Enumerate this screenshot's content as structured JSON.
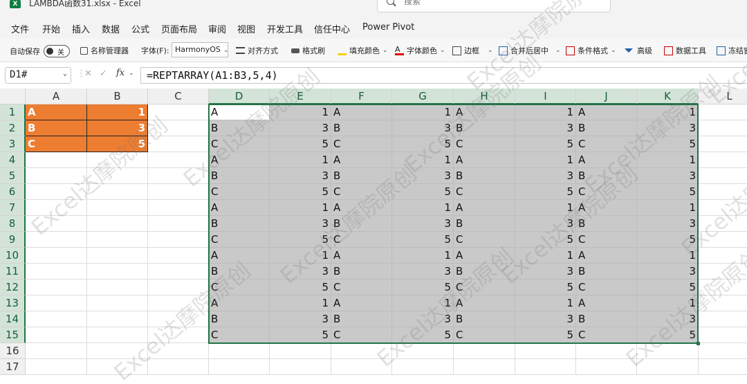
{
  "window": {
    "title": "LAMBDA函数31.xlsx  -  Excel",
    "app_icon": "X",
    "search_placeholder": "搜索"
  },
  "menu": [
    "文件",
    "开始",
    "插入",
    "数据",
    "公式",
    "页面布局",
    "审阅",
    "视图",
    "开发工具",
    "信任中心",
    "Power Pivot"
  ],
  "ribbon": {
    "autosave_label": "自动保存",
    "autosave_state": "关",
    "name_manager": "名称管理器",
    "font_label": "字体(F):",
    "font_value": "HarmonyOS",
    "align": "对齐方式",
    "format_painter": "格式刷",
    "fill_color": "填充颜色",
    "font_color": "字体颜色",
    "border": "边框",
    "merge_center": "合并后居中",
    "conditional_format": "条件格式",
    "advanced": "高级",
    "data_tools": "数据工具",
    "freeze": "冻结窗"
  },
  "formula_bar": {
    "name_box": "D1#",
    "fx": "fx",
    "cancel": "✕",
    "enter": "✓",
    "formula": "=REPTARRAY(A1:B3,5,4)"
  },
  "columns": [
    "A",
    "B",
    "C",
    "D",
    "E",
    "F",
    "G",
    "H",
    "I",
    "J",
    "K",
    "L"
  ],
  "rows": [
    "1",
    "2",
    "3",
    "4",
    "5",
    "6",
    "7",
    "8",
    "9",
    "10",
    "11",
    "12",
    "13",
    "14",
    "15",
    "16",
    "17"
  ],
  "source": [
    [
      "A",
      "1"
    ],
    [
      "B",
      "3"
    ],
    [
      "C",
      "5"
    ]
  ],
  "spill": [
    [
      "A",
      "1",
      "A",
      "1",
      "A",
      "1",
      "A",
      "1"
    ],
    [
      "B",
      "3",
      "B",
      "3",
      "B",
      "3",
      "B",
      "3"
    ],
    [
      "C",
      "5",
      "C",
      "5",
      "C",
      "5",
      "C",
      "5"
    ],
    [
      "A",
      "1",
      "A",
      "1",
      "A",
      "1",
      "A",
      "1"
    ],
    [
      "B",
      "3",
      "B",
      "3",
      "B",
      "3",
      "B",
      "3"
    ],
    [
      "C",
      "5",
      "C",
      "5",
      "C",
      "5",
      "C",
      "5"
    ],
    [
      "A",
      "1",
      "A",
      "1",
      "A",
      "1",
      "A",
      "1"
    ],
    [
      "B",
      "3",
      "B",
      "3",
      "B",
      "3",
      "B",
      "3"
    ],
    [
      "C",
      "5",
      "C",
      "5",
      "C",
      "5",
      "C",
      "5"
    ],
    [
      "A",
      "1",
      "A",
      "1",
      "A",
      "1",
      "A",
      "1"
    ],
    [
      "B",
      "3",
      "B",
      "3",
      "B",
      "3",
      "B",
      "3"
    ],
    [
      "C",
      "5",
      "C",
      "5",
      "C",
      "5",
      "C",
      "5"
    ],
    [
      "A",
      "1",
      "A",
      "1",
      "A",
      "1",
      "A",
      "1"
    ],
    [
      "B",
      "3",
      "B",
      "3",
      "B",
      "3",
      "B",
      "3"
    ],
    [
      "C",
      "5",
      "C",
      "5",
      "C",
      "5",
      "C",
      "5"
    ]
  ],
  "watermark": "Excel达摩院原创",
  "colors": {
    "accent": "#217346",
    "source_fill": "#ed7d31",
    "spill_fill": "#c9c9c9"
  }
}
